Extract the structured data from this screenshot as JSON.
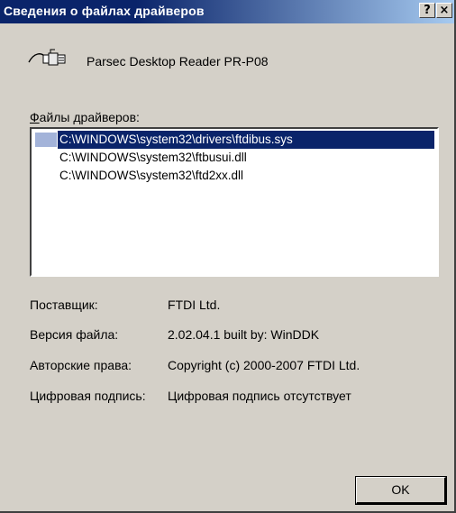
{
  "window": {
    "title": "Сведения о файлах драйверов",
    "help_button": "?",
    "close_button": "×"
  },
  "device": {
    "icon": "usb-plug-icon",
    "name": "Parsec Desktop Reader PR-P08"
  },
  "files": {
    "label_hotkey": "Ф",
    "label_rest": "айлы драйверов:",
    "items": [
      "C:\\WINDOWS\\system32\\drivers\\ftdibus.sys",
      "C:\\WINDOWS\\system32\\ftbusui.dll",
      "C:\\WINDOWS\\system32\\ftd2xx.dll"
    ],
    "selected": "C:\\WINDOWS\\system32\\drivers\\ftdibus.sys"
  },
  "properties": {
    "provider_label": "Поставщик:",
    "provider_value": "FTDI Ltd.",
    "version_label": "Версия файла:",
    "version_value": "2.02.04.1 built by: WinDDK",
    "copyright_label": "Авторские права:",
    "copyright_value": "Copyright (c) 2000-2007 FTDI Ltd.",
    "signature_label": "Цифровая подпись:",
    "signature_value": "Цифровая подпись отсутствует"
  },
  "buttons": {
    "ok_label": "OK"
  },
  "colors": {
    "title_bar": "#0a246a",
    "selection": "#0a246a",
    "dialog_bg": "#d4d0c8"
  }
}
